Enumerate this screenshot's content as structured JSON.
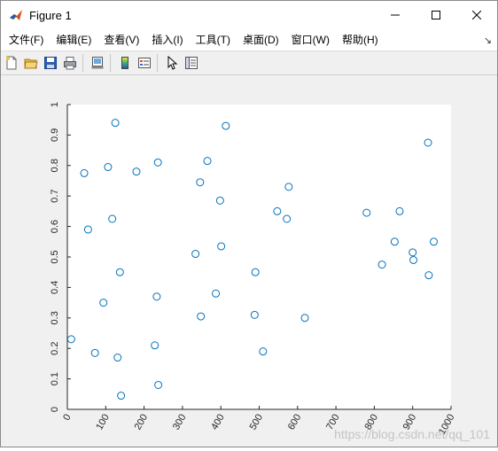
{
  "window": {
    "title": "Figure 1",
    "controls": {
      "minimize": "—",
      "maximize": "☐",
      "close": "✕"
    }
  },
  "menu": {
    "items": [
      {
        "label": "文件(F)"
      },
      {
        "label": "编辑(E)"
      },
      {
        "label": "查看(V)"
      },
      {
        "label": "插入(I)"
      },
      {
        "label": "工具(T)"
      },
      {
        "label": "桌面(D)"
      },
      {
        "label": "窗口(W)"
      },
      {
        "label": "帮助(H)"
      }
    ],
    "overflow_icon": "dock-arrow-icon"
  },
  "toolbar": {
    "buttons": [
      "new-figure-icon",
      "open-file-icon",
      "save-icon",
      "print-icon",
      "link-plot-icon",
      "insert-colorbar-icon",
      "insert-legend-icon",
      "edit-plot-icon",
      "property-inspector-icon"
    ]
  },
  "watermark": "https://blog.csdn.net/qq_101",
  "colors": {
    "marker": "#0072bd",
    "axes_bg": "#ffffff",
    "figure_bg": "#f0f0f0"
  },
  "chart_data": {
    "type": "scatter",
    "title": "",
    "xlabel": "",
    "ylabel": "",
    "xlim": [
      0,
      1000
    ],
    "ylim": [
      0,
      1
    ],
    "xticks": [
      0,
      100,
      200,
      300,
      400,
      500,
      600,
      700,
      800,
      900,
      1000
    ],
    "yticks": [
      0,
      0.1,
      0.2,
      0.3,
      0.4,
      0.5,
      0.6,
      0.7,
      0.8,
      0.9,
      1
    ],
    "grid": false,
    "marker": "circle-open",
    "x": [
      10,
      44,
      54,
      72,
      94,
      106,
      117,
      125,
      131,
      137,
      140,
      180,
      228,
      233,
      236,
      237,
      334,
      346,
      348,
      365,
      387,
      398,
      401,
      413,
      488,
      490,
      510,
      547,
      572,
      577,
      619,
      780,
      820,
      853,
      866,
      900,
      902,
      940,
      942,
      955
    ],
    "y": [
      0.23,
      0.775,
      0.59,
      0.185,
      0.35,
      0.795,
      0.625,
      0.94,
      0.17,
      0.45,
      0.045,
      0.78,
      0.21,
      0.37,
      0.81,
      0.08,
      0.51,
      0.745,
      0.305,
      0.815,
      0.38,
      0.685,
      0.535,
      0.93,
      0.31,
      0.45,
      0.19,
      0.65,
      0.625,
      0.73,
      0.3,
      0.645,
      0.475,
      0.55,
      0.65,
      0.515,
      0.49,
      0.875,
      0.44,
      0.55
    ]
  }
}
